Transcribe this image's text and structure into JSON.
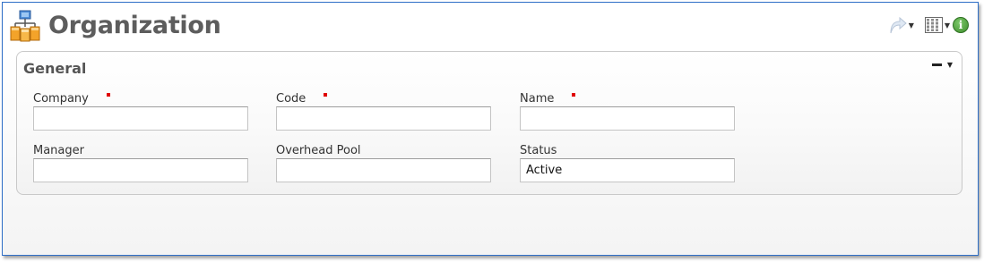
{
  "header": {
    "title": "Organization",
    "icons": {
      "app": "organization-chart-icon",
      "share": "share-arrow-icon",
      "columns": "columns-icon",
      "info": "info-icon"
    },
    "info_glyph": "i"
  },
  "panel": {
    "title": "General",
    "collapse_icon": "collapse-minus-icon"
  },
  "fields": {
    "company": {
      "label": "Company",
      "value": "",
      "required": true
    },
    "code": {
      "label": "Code",
      "value": "",
      "required": true
    },
    "name": {
      "label": "Name",
      "value": "",
      "required": true
    },
    "manager": {
      "label": "Manager",
      "value": ""
    },
    "overhead_pool": {
      "label": "Overhead Pool",
      "value": ""
    },
    "status": {
      "label": "Status",
      "value": "Active"
    }
  },
  "colors": {
    "border_accent": "#2f6fc7",
    "title_text": "#5d5d5d",
    "required_marker": "#e00000",
    "info_green": "#3e8e2c"
  }
}
